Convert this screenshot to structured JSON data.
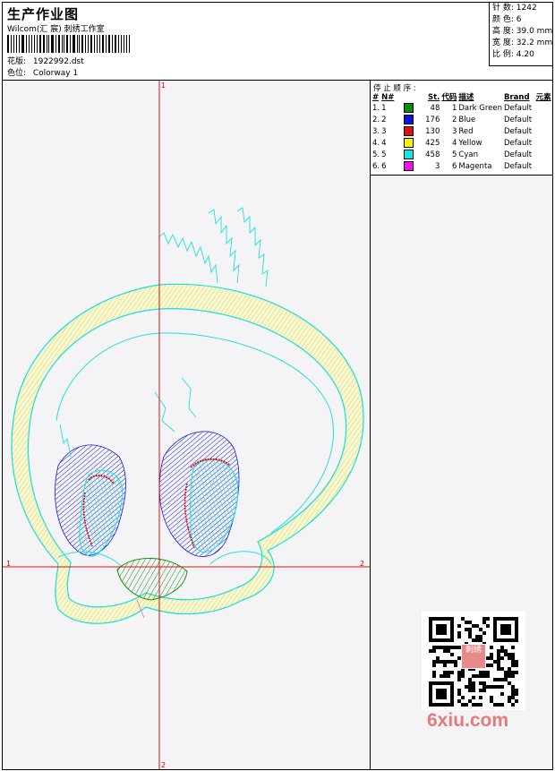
{
  "header": {
    "title": "生产作业图",
    "company": "Wilcom(汇 宸) 刺绣工作室",
    "design_label": "花版:",
    "design_value": "1922992.dst",
    "colorway_label": "色位:",
    "colorway_value": "Colorway 1"
  },
  "stats": [
    {
      "label": "针 数:",
      "value": "1242"
    },
    {
      "label": "颜 色:",
      "value": "6"
    },
    {
      "label": "高 度:",
      "value": "39.0 mm"
    },
    {
      "label": "宽 度:",
      "value": "32.2 mm"
    },
    {
      "label": "比 例:",
      "value": "4.20"
    }
  ],
  "axes": {
    "y_top": "1",
    "x_left": "1",
    "x_right": "2",
    "y_bottom": "2"
  },
  "stop_list": {
    "title": "停 止 顺 序 :",
    "columns": [
      "#",
      "N#",
      "St.",
      "代码",
      "描述",
      "Brand",
      "元素"
    ],
    "rows": [
      {
        "idx": "1.",
        "n": "1",
        "color": "#0a8a0a",
        "st": "48",
        "code": "1",
        "desc": "Dark Green",
        "brand": "Default"
      },
      {
        "idx": "2.",
        "n": "2",
        "color": "#1010e0",
        "st": "176",
        "code": "2",
        "desc": "Blue",
        "brand": "Default"
      },
      {
        "idx": "3.",
        "n": "3",
        "color": "#e01010",
        "st": "130",
        "code": "3",
        "desc": "Red",
        "brand": "Default"
      },
      {
        "idx": "4.",
        "n": "4",
        "color": "#f5f500",
        "st": "425",
        "code": "4",
        "desc": "Yellow",
        "brand": "Default"
      },
      {
        "idx": "5.",
        "n": "5",
        "color": "#10e8e8",
        "st": "458",
        "code": "5",
        "desc": "Cyan",
        "brand": "Default"
      },
      {
        "idx": "6.",
        "n": "6",
        "color": "#f010f0",
        "st": "3",
        "code": "6",
        "desc": "Magenta",
        "brand": "Default"
      }
    ]
  },
  "watermark": "6xiu.com",
  "qr_stamp": "刺绣"
}
